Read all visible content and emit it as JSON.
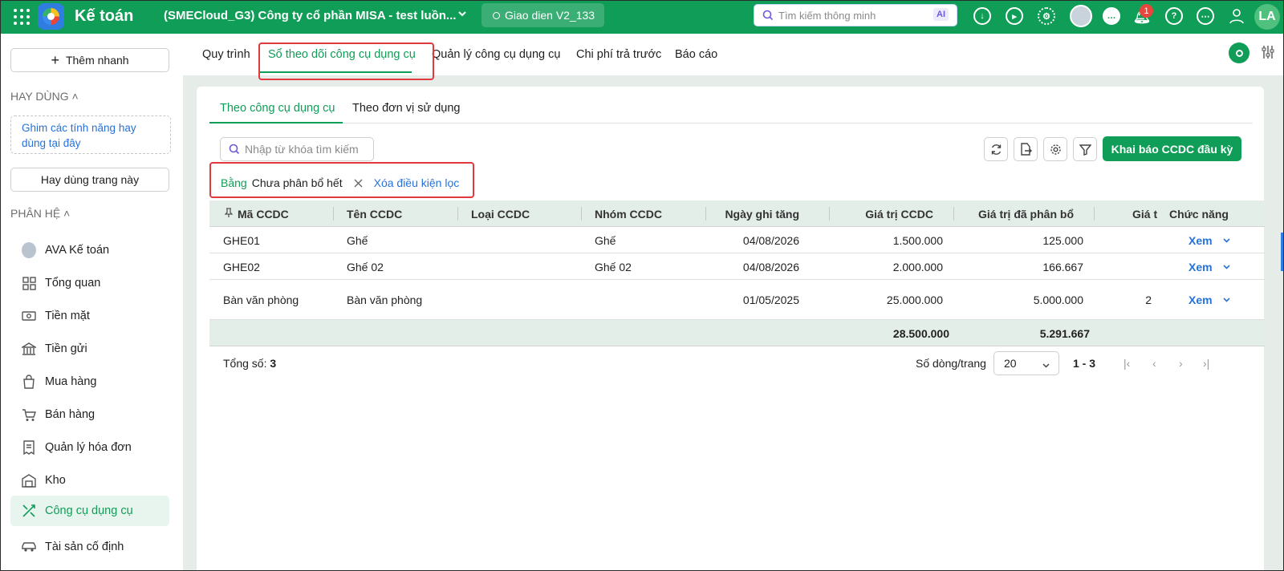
{
  "header": {
    "app_name": "Kế toán",
    "company": "(SMECloud_G3) Công ty cổ phần MISA - test luồn...",
    "theme": "Giao dien V2_133",
    "search_placeholder": "Tìm kiếm thông minh",
    "ai_label": "AI",
    "notification_count": "1",
    "user_initials": "LA",
    "accent_color": "#109d57"
  },
  "sidebar": {
    "quick_add": "Thêm nhanh",
    "frequent_title": "HAY DÙNG",
    "pin_hint": "Ghim các tính năng hay dùng tại đây",
    "frequent_button": "Hay dùng trang này",
    "modules_title": "PHÂN HỆ",
    "items": [
      {
        "label": "AVA Kế toán",
        "icon": "ava-avatar-icon"
      },
      {
        "label": "Tổng quan",
        "icon": "dashboard-icon"
      },
      {
        "label": "Tiền mặt",
        "icon": "cash-icon"
      },
      {
        "label": "Tiền gửi",
        "icon": "bank-icon"
      },
      {
        "label": "Mua hàng",
        "icon": "shopping-bag-icon"
      },
      {
        "label": "Bán hàng",
        "icon": "cart-icon"
      },
      {
        "label": "Quản lý hóa đơn",
        "icon": "invoice-icon"
      },
      {
        "label": "Kho",
        "icon": "warehouse-icon"
      },
      {
        "label": "Công cụ dụng cụ",
        "icon": "tools-icon"
      },
      {
        "label": "Tài sản cố định",
        "icon": "car-icon"
      }
    ]
  },
  "tabs": [
    "Quy trình",
    "Sổ theo dõi công cụ dụng cụ",
    "Quản lý công cụ dụng cụ",
    "Chi phí trả trước",
    "Báo cáo"
  ],
  "subtabs": [
    "Theo công cụ dụng cụ",
    "Theo đơn vị sử dụng"
  ],
  "toolbar": {
    "search_placeholder": "Nhập từ khóa tìm kiếm",
    "primary_button": "Khai báo CCDC đầu kỳ"
  },
  "filter": {
    "field": "Bằng",
    "value": "Chưa phân bổ hết",
    "clear": "Xóa điều kiện lọc"
  },
  "table": {
    "columns": [
      "Mã CCDC",
      "Tên CCDC",
      "Loại CCDC",
      "Nhóm CCDC",
      "Ngày ghi tăng",
      "Giá trị CCDC",
      "Giá trị đã phân bổ",
      "Giá t",
      "Chức năng"
    ],
    "rows": [
      {
        "ma": "GHE01",
        "ten": "Ghế",
        "loai": "",
        "nhom": "Ghế",
        "ngay": "04/08/2026",
        "gia_tri": "1.500.000",
        "da_phan_bo": "125.000",
        "gia_t": "",
        "action": "Xem"
      },
      {
        "ma": "GHE02",
        "ten": "Ghế 02",
        "loai": "",
        "nhom": "Ghế 02",
        "ngay": "04/08/2026",
        "gia_tri": "2.000.000",
        "da_phan_bo": "166.667",
        "gia_t": "",
        "action": "Xem"
      },
      {
        "ma": "Bàn văn phòng",
        "ten": "Bàn văn phòng",
        "loai": "",
        "nhom": "",
        "ngay": "01/05/2025",
        "gia_tri": "25.000.000",
        "da_phan_bo": "5.000.000",
        "gia_t": "2",
        "action": "Xem"
      }
    ],
    "totals": {
      "gia_tri": "28.500.000",
      "da_phan_bo": "5.291.667"
    }
  },
  "pager": {
    "total_label": "Tổng số:",
    "total": "3",
    "page_size_label": "Số dòng/trang",
    "page_size": "20",
    "range": "1 - 3"
  }
}
